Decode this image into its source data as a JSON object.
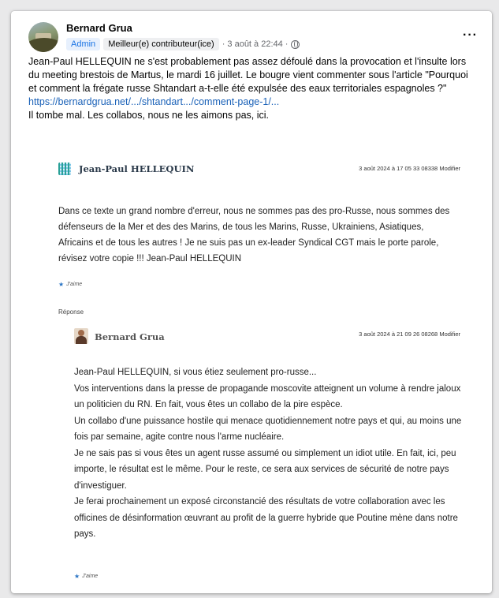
{
  "post": {
    "author": "Bernard Grua",
    "badge_admin": "Admin",
    "badge_top": "Meilleur(e) contributeur(ice)",
    "date": "· 3 août à 22:44 ·",
    "more": "···",
    "text1": "Jean-Paul HELLEQUIN ne s'est probablement pas assez défoulé dans la provocation et l'insulte lors du meeting brestois de Martus, le mardi 16 juillet. Le bougre vient commenter sous l'article \"Pourquoi et comment la frégate russe Shtandart a-t-elle été expulsée des eaux territoriales espagnoles ?\"",
    "link": "https://bernardgrua.net/.../shtandart.../comment-page-1/...",
    "text2": "Il tombe mal. Les collabos, nous ne les aimons pas, ici."
  },
  "comment1": {
    "author": "Jean-Paul HELLEQUIN",
    "date": "3 août 2024 à 17 05 33 08338 Modifier",
    "body": "Dans ce texte un grand nombre d'erreur, nous ne sommes pas des pro-Russe, nous sommes des défenseurs de la Mer et des des Marins, de tous les Marins, Russe, Ukrainiens, Asiatiques, Africains et de tous les autres ! Je ne suis pas un ex-leader Syndical CGT mais le porte parole, révisez votre copie !!! Jean-Paul HELLEQUIN",
    "like": "J'aime"
  },
  "reply_label": "Réponse",
  "comment2": {
    "author": "Bernard Grua",
    "date": "3 août 2024 à 21 09 26 08268 Modifier",
    "lines": [
      "Jean-Paul HELLEQUIN, si vous étiez seulement pro-russe...",
      "Vos interventions dans la presse de propagande moscovite atteignent un volume à rendre jaloux un politicien du RN. En fait, vous êtes un collabo de la pire espèce.",
      "Un collabo d'une puissance hostile qui menace quotidiennement notre pays et qui, au moins une fois par semaine, agite contre nous l'arme nucléaire.",
      "Je ne sais pas si vous êtes un agent russe assumé ou simplement un idiot utile. En fait, ici, peu importe, le résultat est le même. Pour le reste, ce sera aux services de sécurité de notre pays d'investiguer.",
      "Je ferai prochainement un exposé circonstancié des résultats de votre collaboration avec les officines de désinformation œuvrant au profit de la guerre hybride que Poutine mène dans notre pays."
    ],
    "like": "J'aime"
  },
  "colors": {
    "link": "#1b62b8",
    "admin_badge": "#1b74e4",
    "star": "#2a74c4"
  },
  "icons": {
    "more": "more-icon",
    "globe": "globe-icon",
    "star": "star-icon"
  }
}
